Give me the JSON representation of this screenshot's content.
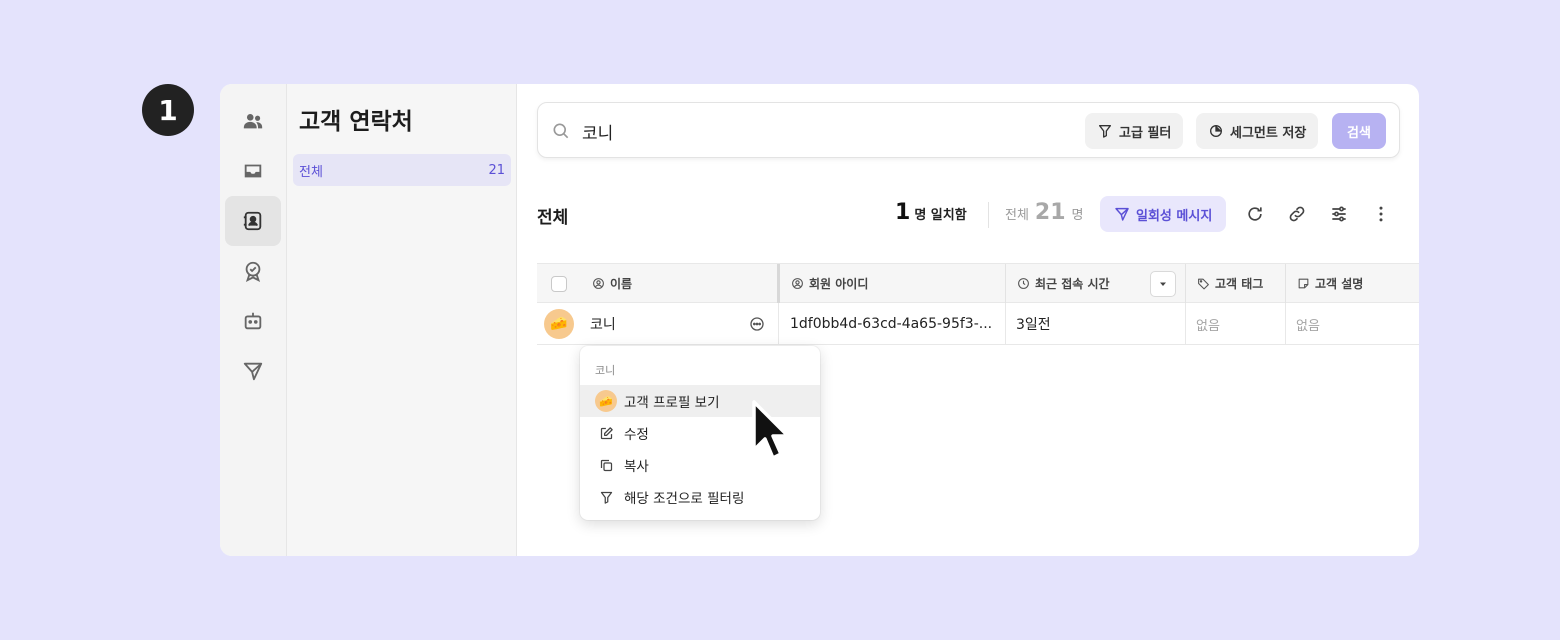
{
  "step_number": "1",
  "sidebar_rail": {
    "items": [
      {
        "icon": "people-icon",
        "active": false
      },
      {
        "icon": "inbox-icon",
        "active": false
      },
      {
        "icon": "contacts-icon",
        "active": true
      },
      {
        "icon": "badge-check-icon",
        "active": false
      },
      {
        "icon": "bot-icon",
        "active": false
      },
      {
        "icon": "send-icon",
        "active": false
      }
    ]
  },
  "panel": {
    "title": "고객 연락처",
    "items": [
      {
        "label": "전체",
        "count": "21"
      }
    ]
  },
  "search": {
    "value": "코니",
    "advanced_filter_label": "고급 필터",
    "save_segment_label": "세그먼트 저장",
    "search_button_label": "검색"
  },
  "toolbar": {
    "title": "전체",
    "match_count": "1",
    "match_label": "명 일치함",
    "total_prefix": "전체",
    "total_count": "21",
    "total_suffix": "명",
    "one_time_message_label": "일회성 메시지"
  },
  "table": {
    "columns": [
      {
        "key": "name",
        "label": "이름",
        "icon": "user-circle-icon"
      },
      {
        "key": "member_id",
        "label": "회원 아이디",
        "icon": "user-circle-icon"
      },
      {
        "key": "last_access",
        "label": "최근 접속 시간",
        "icon": "clock-icon"
      },
      {
        "key": "tags",
        "label": "고객 태그",
        "icon": "tag-icon"
      },
      {
        "key": "description",
        "label": "고객 설명",
        "icon": "note-icon"
      }
    ],
    "rows": [
      {
        "avatar": "🧀",
        "name": "코니",
        "member_id": "1df0bb4d-63cd-4a65-95f3-...",
        "last_access": "3일전",
        "tags": "없음",
        "description": "없음"
      }
    ]
  },
  "context_menu": {
    "header": "코니",
    "items": [
      {
        "label": "고객 프로필 보기",
        "icon": "avatar",
        "highlighted": true
      },
      {
        "label": "수정",
        "icon": "edit-icon",
        "highlighted": false
      },
      {
        "label": "복사",
        "icon": "copy-icon",
        "highlighted": false
      },
      {
        "label": "해당 조건으로 필터링",
        "icon": "filter-icon",
        "highlighted": false
      }
    ]
  },
  "colors": {
    "background": "#e4e3fc",
    "accent": "#5b50d6",
    "accent_light": "#e9e7fc",
    "search_button": "#b7b2f2"
  }
}
